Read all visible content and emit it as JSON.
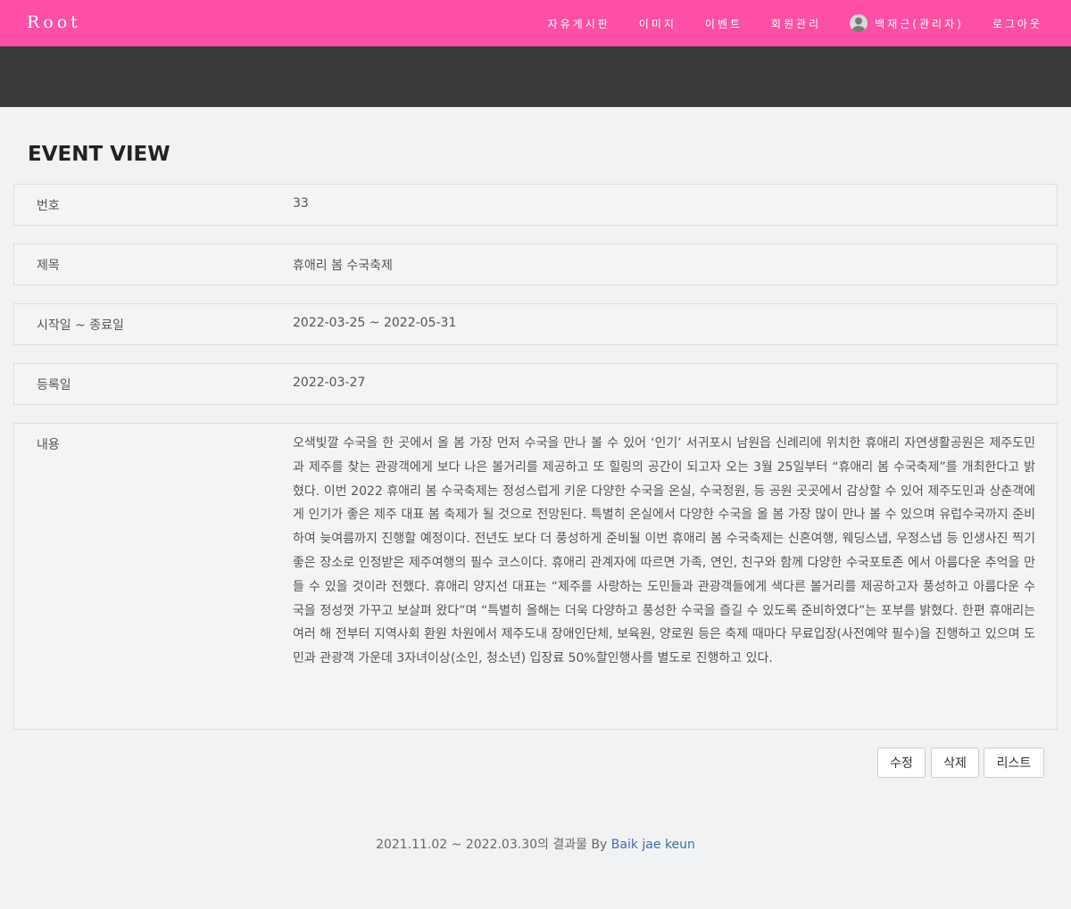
{
  "navbar": {
    "brand": "Root",
    "links": [
      "자유게시판",
      "이미지",
      "이벤트",
      "회원관리"
    ],
    "user": "백재근(관리자)",
    "logout": "로그아웃"
  },
  "page_title": "EVENT VIEW",
  "fields": {
    "number": {
      "label": "번호",
      "value": "33"
    },
    "title": {
      "label": "제목",
      "value": "휴애리 봄 수국축제"
    },
    "period": {
      "label": "시작일 ~ 종료일",
      "value": "2022-03-25 ~ 2022-05-31"
    },
    "registered": {
      "label": "등록일",
      "value": "2022-03-27"
    },
    "content": {
      "label": "내용",
      "value": "오색빛깔 수국을 한 곳에서 올 봄 가장 먼저 수국을 만나 볼 수 있어 ‘인기’ 서귀포시 남원읍 신례리에 위치한 휴애리 자연생활공원은 제주도민과 제주를 찾는 관광객에게 보다 나은 볼거리를 제공하고 또 힐링의 공간이 되고자 오는 3월 25일부터 “휴애리 봄 수국축제”를 개최한다고 밝혔다. 이번 2022 휴애리 봄 수국축제는 정성스럽게 키운 다양한 수국을 온실, 수국정원, 등 공원 곳곳에서 감상할 수 있어 제주도민과 상춘객에게 인기가 좋은 제주 대표 봄 축제가 될 것으로 전망된다. 특별히 온실에서 다양한 수국을 올 봄 가장 많이 만나 볼 수 있으며 유럽수국까지 준비하여 늦여름까지 진행할 예정이다. 전년도 보다 더 풍성하게 준비될 이번 휴애리 봄 수국축제는 신혼여행, 웨딩스냅, 우정스냅 등 인생사진 찍기 좋은 장소로 인정받은 제주여행의 필수 코스이다. 휴애리 관계자에 따르면 가족, 연인, 친구와 함께 다양한 수국포토존 에서 아름다운 추억을 만들 수 있을 것이라 전했다. 휴애리 양지선 대표는 “제주를 사랑하는 도민들과 관광객들에게 색다른 볼거리를 제공하고자 풍성하고 아름다운 수국을 정성껏 가꾸고 보살펴 왔다”며 “특별히 올해는 더욱 다양하고 풍성한 수국을 즐길 수 있도록 준비하였다”는 포부를 밝혔다. 한편 휴애리는 여러 해 전부터 지역사회 환원 차원에서 제주도내 장애인단체, 보육원, 양로원 등은 축제 때마다 무료입장(사전예약 필수)을 진행하고 있으며 도민과 관광객 가운데 3자녀이상(소인, 청소년) 입장료 50%할인행사를 별도로 진행하고 있다."
    }
  },
  "buttons": {
    "edit": "수정",
    "delete": "삭제",
    "list": "리스트"
  },
  "footer": {
    "text": "2021.11.02 ~ 2022.03.30의 결과물 By ",
    "author": "Baik jae keun"
  },
  "colors": {
    "navbar": "#fd4fa5",
    "hero": "#3a3a3a",
    "link": "#3b6fa8"
  }
}
